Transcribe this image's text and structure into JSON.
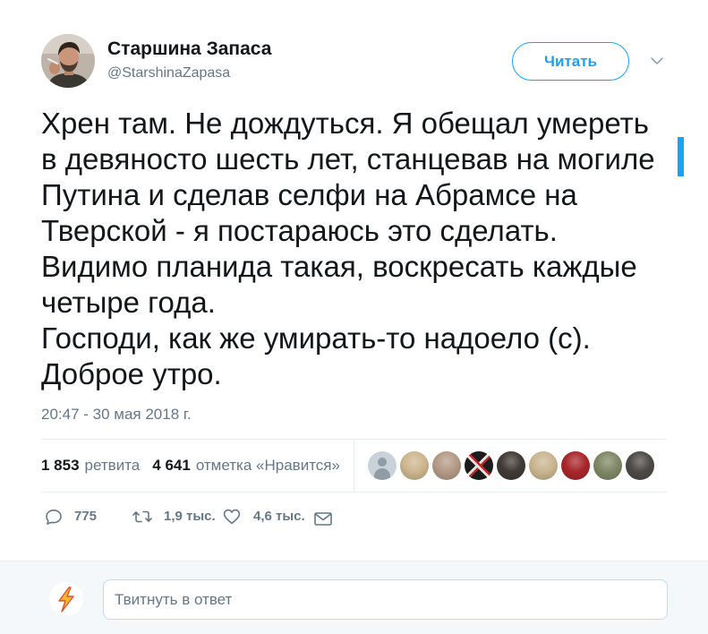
{
  "tweet": {
    "author": {
      "name": "Старшина Запаса",
      "handle": "@StarshinaZapasa",
      "avatar_icon": "author-avatar-photo"
    },
    "follow_button": {
      "label": "Читать"
    },
    "more_menu_icon": "chevron-down-icon",
    "text_lines": [
      "Хрен там. Не дождуться. Я обещал умереть",
      "в девяносто шесть лет, станцевав на могиле",
      "Путина и сделав селфи на Абрамсе на",
      "Тверской - я постараюсь это сделать.",
      "Видимо планида такая, воскресать каждые",
      "четыре года.",
      "Господи, как же умирать-то надоело (с).",
      "Доброе утро."
    ],
    "timestamp": "20:47 - 30 мая 2018 г.",
    "stats": {
      "retweets": {
        "count": "1 853",
        "label": "ретвита"
      },
      "likes": {
        "count": "4 641",
        "label": "отметка «Нравится»"
      },
      "liker_avatar_colors": [
        "#c9d2d9",
        "#cdb68f",
        "#b49a86",
        "#1c1b1d",
        "#403a36",
        "#c9b590",
        "#a8262b",
        "#7f8766",
        "#4d4a46"
      ]
    },
    "actions": {
      "reply": {
        "icon": "reply-icon",
        "count": "775"
      },
      "retweet": {
        "icon": "retweet-icon",
        "count": "1,9 тыс."
      },
      "like": {
        "icon": "heart-icon",
        "count": "4,6 тыс."
      },
      "direct_message": {
        "icon": "envelope-icon"
      }
    }
  },
  "reply_box": {
    "placeholder": "Твитнуть в ответ",
    "user_avatar_icon": "lightning-bolt-icon"
  },
  "colors": {
    "accent": "#1da1f2",
    "text_primary": "#14171a",
    "text_secondary": "#657786",
    "divider": "#e6ecf0",
    "footer_background": "#f5f8fa",
    "input_border": "#bddcf2"
  }
}
